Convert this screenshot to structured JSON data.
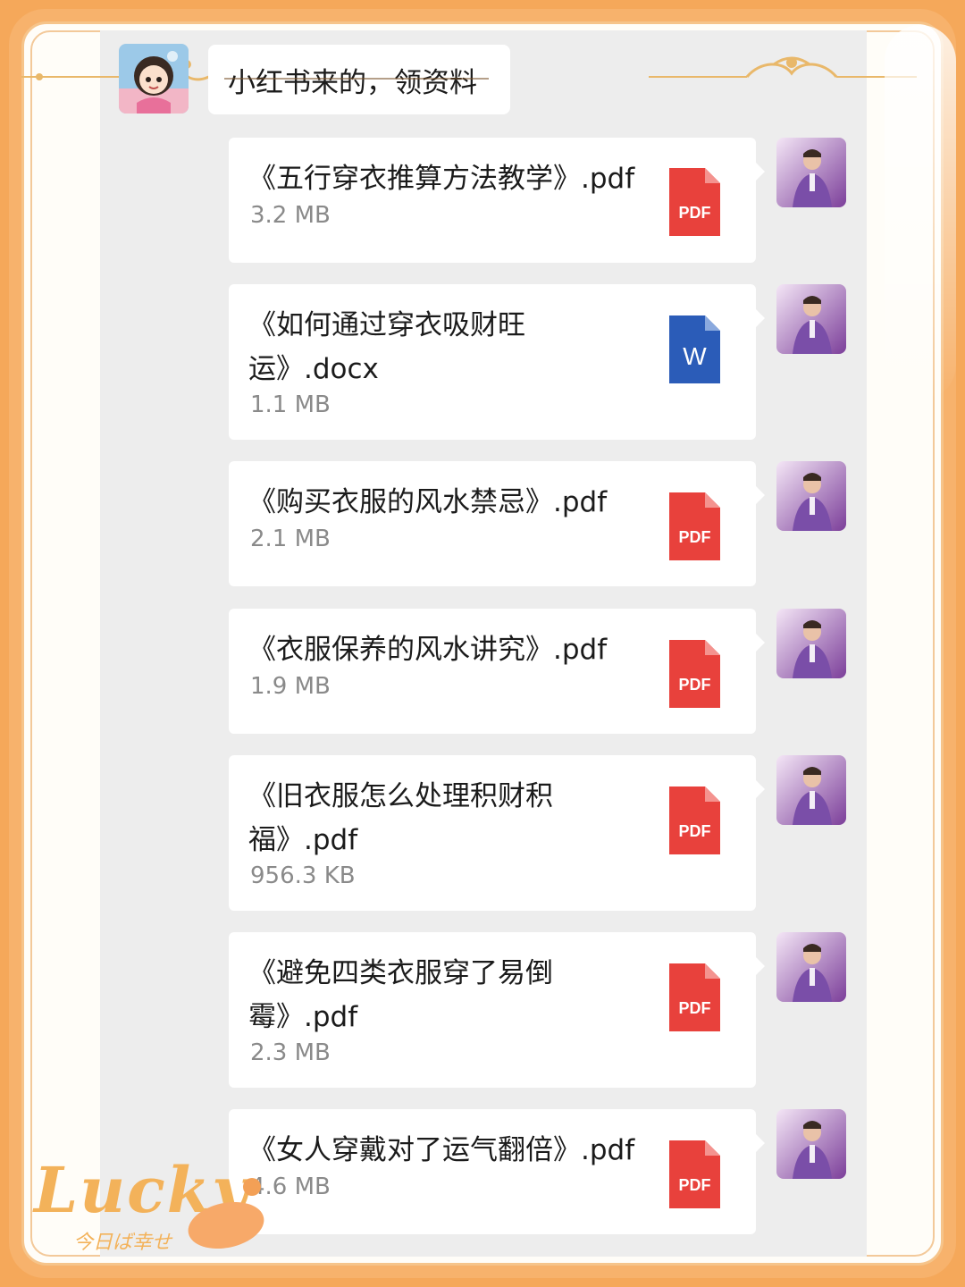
{
  "chat": {
    "incoming": {
      "avatar_icon": "cartoon-girl-avatar",
      "text": "小红书来的，领资料"
    },
    "outgoing_avatar_icon": "man-purple-suit-avatar",
    "files": [
      {
        "name": "《五行穿衣推算方法教学》.pdf",
        "size": "3.2 MB",
        "type": "PDF",
        "icon": "pdf-file-icon"
      },
      {
        "name": "《如何通过穿衣吸财旺运》.docx",
        "size": "1.1 MB",
        "type": "W",
        "icon": "word-file-icon"
      },
      {
        "name": "《购买衣服的风水禁忌》.pdf",
        "size": "2.1 MB",
        "type": "PDF",
        "icon": "pdf-file-icon"
      },
      {
        "name": "《衣服保养的风水讲究》.pdf",
        "size": "1.9 MB",
        "type": "PDF",
        "icon": "pdf-file-icon"
      },
      {
        "name": "《旧衣服怎么处理积财积福》.pdf",
        "size": "956.3 KB",
        "type": "PDF",
        "icon": "pdf-file-icon"
      },
      {
        "name": "《避免四类衣服穿了易倒霉》.pdf",
        "size": "2.3 MB",
        "type": "PDF",
        "icon": "pdf-file-icon"
      },
      {
        "name": "《女人穿戴对了运气翻倍》.pdf",
        "size": "4.6 MB",
        "type": "PDF",
        "icon": "pdf-file-icon"
      }
    ]
  },
  "decoration": {
    "lucky_text": "Lucky",
    "lucky_subtext": "今日ば幸せ"
  },
  "colors": {
    "frame": "#f5a85a",
    "pdf_red": "#e8413c",
    "word_blue": "#2b5cb8",
    "chat_bg": "#ededed"
  }
}
